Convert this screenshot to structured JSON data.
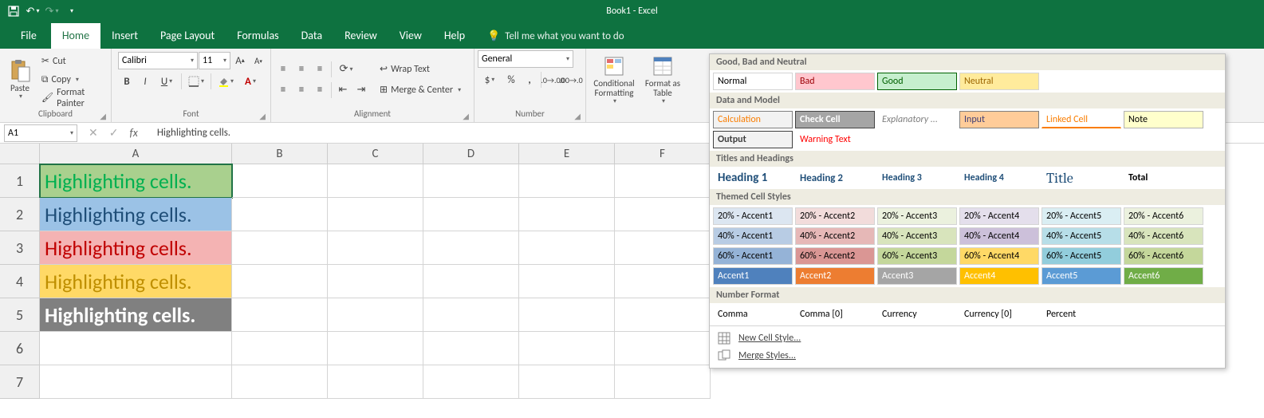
{
  "title": "Book1  -  Excel",
  "qat": {
    "save": "💾",
    "undo": "↶",
    "redo": "↷"
  },
  "tabs": {
    "file": "File",
    "home": "Home",
    "insert": "Insert",
    "pagelayout": "Page Layout",
    "formulas": "Formulas",
    "data": "Data",
    "review": "Review",
    "view": "View",
    "help": "Help",
    "tellme": "Tell me what you want to do"
  },
  "clipboard": {
    "paste": "Paste",
    "cut": "Cut",
    "copy": "Copy",
    "fmtpainter": "Format Painter",
    "label": "Clipboard"
  },
  "font": {
    "name": "Calibri",
    "size": "11",
    "label": "Font"
  },
  "alignment": {
    "wrap": "Wrap Text",
    "merge": "Merge & Center",
    "label": "Alignment"
  },
  "number": {
    "format": "General",
    "label": "Number"
  },
  "styles": {
    "cond": "Conditional\nFormatting",
    "table": "Format as\nTable"
  },
  "fbar": {
    "ref": "A1",
    "value": "Highlighting cells."
  },
  "cols": [
    "A",
    "B",
    "C",
    "D",
    "E",
    "F"
  ],
  "rows": [
    "1",
    "2",
    "3",
    "4",
    "5",
    "6",
    "7"
  ],
  "cells": {
    "a1": {
      "text": "Highlighting cells.",
      "bg": "#a9d08e",
      "fg": "#00b050"
    },
    "a2": {
      "text": "Highlighting cells.",
      "bg": "#9bc2e6",
      "fg": "#1f4e78"
    },
    "a3": {
      "text": "Highlighting cells.",
      "bg": "#f4b3b3",
      "fg": "#c00000"
    },
    "a4": {
      "text": "Highlighting cells.",
      "bg": "#ffd966",
      "fg": "#bf8f00"
    },
    "a5": {
      "text": "Highlighting cells.",
      "bg": "#808080",
      "fg": "#ffffff"
    }
  },
  "panel": {
    "s1": "Good, Bad and Neutral",
    "gbn": [
      {
        "t": "Normal",
        "bg": "#ffffff",
        "fg": "#000000",
        "b": "#d4d4d4"
      },
      {
        "t": "Bad",
        "bg": "#ffc7ce",
        "fg": "#9c0006",
        "b": "#d4d4d4"
      },
      {
        "t": "Good",
        "bg": "#c6efce",
        "fg": "#006100",
        "b": "#006100"
      },
      {
        "t": "Neutral",
        "bg": "#ffeb9c",
        "fg": "#9c6500",
        "b": "#d4d4d4"
      }
    ],
    "s2": "Data and Model",
    "dm": [
      {
        "t": "Calculation",
        "bg": "#f2f2f2",
        "fg": "#fa7d00",
        "b": "#7f7f7f"
      },
      {
        "t": "Check Cell",
        "bg": "#a5a5a5",
        "fg": "#ffffff",
        "b": "#444444",
        "bold": true
      },
      {
        "t": "Explanatory ...",
        "bg": "#ffffff",
        "fg": "#7f7f7f",
        "it": true,
        "b": "transparent"
      },
      {
        "t": "Input",
        "bg": "#ffcc99",
        "fg": "#3f3f76",
        "b": "#7f7f7f"
      },
      {
        "t": "Linked Cell",
        "bg": "#ffffff",
        "fg": "#fa7d00",
        "b": "transparent",
        "ub": "#fa7d00"
      },
      {
        "t": "Note",
        "bg": "#ffffcc",
        "fg": "#000000",
        "b": "#b2b2b2"
      },
      {
        "t": "Output",
        "bg": "#f2f2f2",
        "fg": "#3f3f3f",
        "b": "#3f3f3f",
        "bold": true
      },
      {
        "t": "Warning Text",
        "bg": "#ffffff",
        "fg": "#ff0000",
        "b": "transparent"
      }
    ],
    "s3": "Titles and Headings",
    "th": [
      {
        "t": "Heading 1",
        "fs": "15px",
        "bold": true,
        "fg": "#1f4e78",
        "ub": "#4f81bd"
      },
      {
        "t": "Heading 2",
        "fs": "13px",
        "bold": true,
        "fg": "#1f4e78",
        "ub": "#a6bfde"
      },
      {
        "t": "Heading 3",
        "fs": "12px",
        "bold": true,
        "fg": "#1f4e78",
        "ub": "#95b3d7"
      },
      {
        "t": "Heading 4",
        "fs": "12px",
        "bold": true,
        "fg": "#1f4e78"
      },
      {
        "t": "Title",
        "fs": "18px",
        "fg": "#1f4e78",
        "ff": "Cambria"
      },
      {
        "t": "Total",
        "fs": "12px",
        "bold": true,
        "fg": "#000000",
        "ub": "#4f81bd",
        "ot": "#4f81bd"
      }
    ],
    "s4": "Themed Cell Styles",
    "themed": [
      {
        "t": "20% - Accent1",
        "bg": "#dce6f1"
      },
      {
        "t": "20% - Accent2",
        "bg": "#f2dcdb"
      },
      {
        "t": "20% - Accent3",
        "bg": "#ebf1de"
      },
      {
        "t": "20% - Accent4",
        "bg": "#e4dfec"
      },
      {
        "t": "20% - Accent5",
        "bg": "#daeef3"
      },
      {
        "t": "20% - Accent6",
        "bg": "#ebf1de"
      },
      {
        "t": "40% - Accent1",
        "bg": "#b8cce4"
      },
      {
        "t": "40% - Accent2",
        "bg": "#e6b8b7"
      },
      {
        "t": "40% - Accent3",
        "bg": "#d8e4bc"
      },
      {
        "t": "40% - Accent4",
        "bg": "#ccc0da"
      },
      {
        "t": "40% - Accent5",
        "bg": "#b7dee8"
      },
      {
        "t": "40% - Accent6",
        "bg": "#d8e4bc"
      },
      {
        "t": "60% - Accent1",
        "bg": "#95b3d7"
      },
      {
        "t": "60% - Accent2",
        "bg": "#da9694"
      },
      {
        "t": "60% - Accent3",
        "bg": "#c4d79b"
      },
      {
        "t": "60% - Accent4",
        "bg": "#ffd966"
      },
      {
        "t": "60% - Accent5",
        "bg": "#92cddc"
      },
      {
        "t": "60% - Accent6",
        "bg": "#c4d79b"
      },
      {
        "t": "Accent1",
        "bg": "#4f81bd",
        "fg": "#ffffff"
      },
      {
        "t": "Accent2",
        "bg": "#ed7d31",
        "fg": "#ffffff"
      },
      {
        "t": "Accent3",
        "bg": "#a5a5a5",
        "fg": "#ffffff"
      },
      {
        "t": "Accent4",
        "bg": "#ffc000",
        "fg": "#ffffff"
      },
      {
        "t": "Accent5",
        "bg": "#5b9bd5",
        "fg": "#ffffff"
      },
      {
        "t": "Accent6",
        "bg": "#70ad47",
        "fg": "#ffffff"
      }
    ],
    "s5": "Number Format",
    "nf": [
      {
        "t": "Comma"
      },
      {
        "t": "Comma [0]"
      },
      {
        "t": "Currency"
      },
      {
        "t": "Currency [0]"
      },
      {
        "t": "Percent"
      }
    ],
    "newstyle": "New Cell Style...",
    "mergestyles": "Merge Styles..."
  }
}
